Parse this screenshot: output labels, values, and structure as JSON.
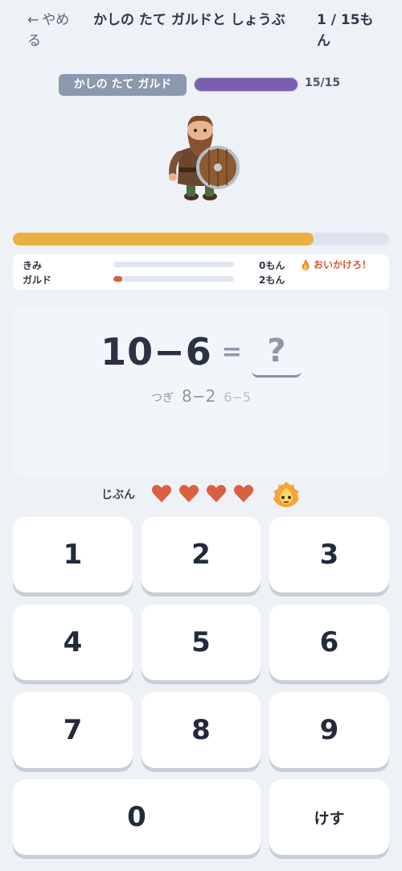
{
  "header": {
    "back_label": "やめる",
    "back_arrow": "←",
    "title": "かしの たて ガルドと しょうぶ",
    "counter": "1 / 15もん"
  },
  "enemy": {
    "name": "かしの たて ガルド",
    "hp_text": "15/15",
    "hp_fraction": 1.0,
    "hp_color": "#7a5fae"
  },
  "timer": {
    "fraction": 0.8,
    "color": "#eab13e"
  },
  "race": {
    "player": {
      "label": "きみ",
      "count": "0もん",
      "fraction": 0
    },
    "enemy": {
      "label": "ガルド",
      "count": "2もん",
      "fraction": 0.07
    },
    "alert": "おいかけろ！",
    "alert_icon": "fire-icon"
  },
  "question": {
    "expression": "10−6",
    "equals": "=",
    "answer_placeholder": "?",
    "next_label": "つぎ",
    "next_items": [
      "8−2",
      "6−5"
    ]
  },
  "lives": {
    "label": "じぶん",
    "count": 4,
    "heart_color": "#d9613f",
    "pet_icon": "fire-spirit-icon"
  },
  "keypad": {
    "keys": [
      "1",
      "2",
      "3",
      "4",
      "5",
      "6",
      "7",
      "8",
      "9",
      "0"
    ],
    "delete_label": "けす"
  }
}
